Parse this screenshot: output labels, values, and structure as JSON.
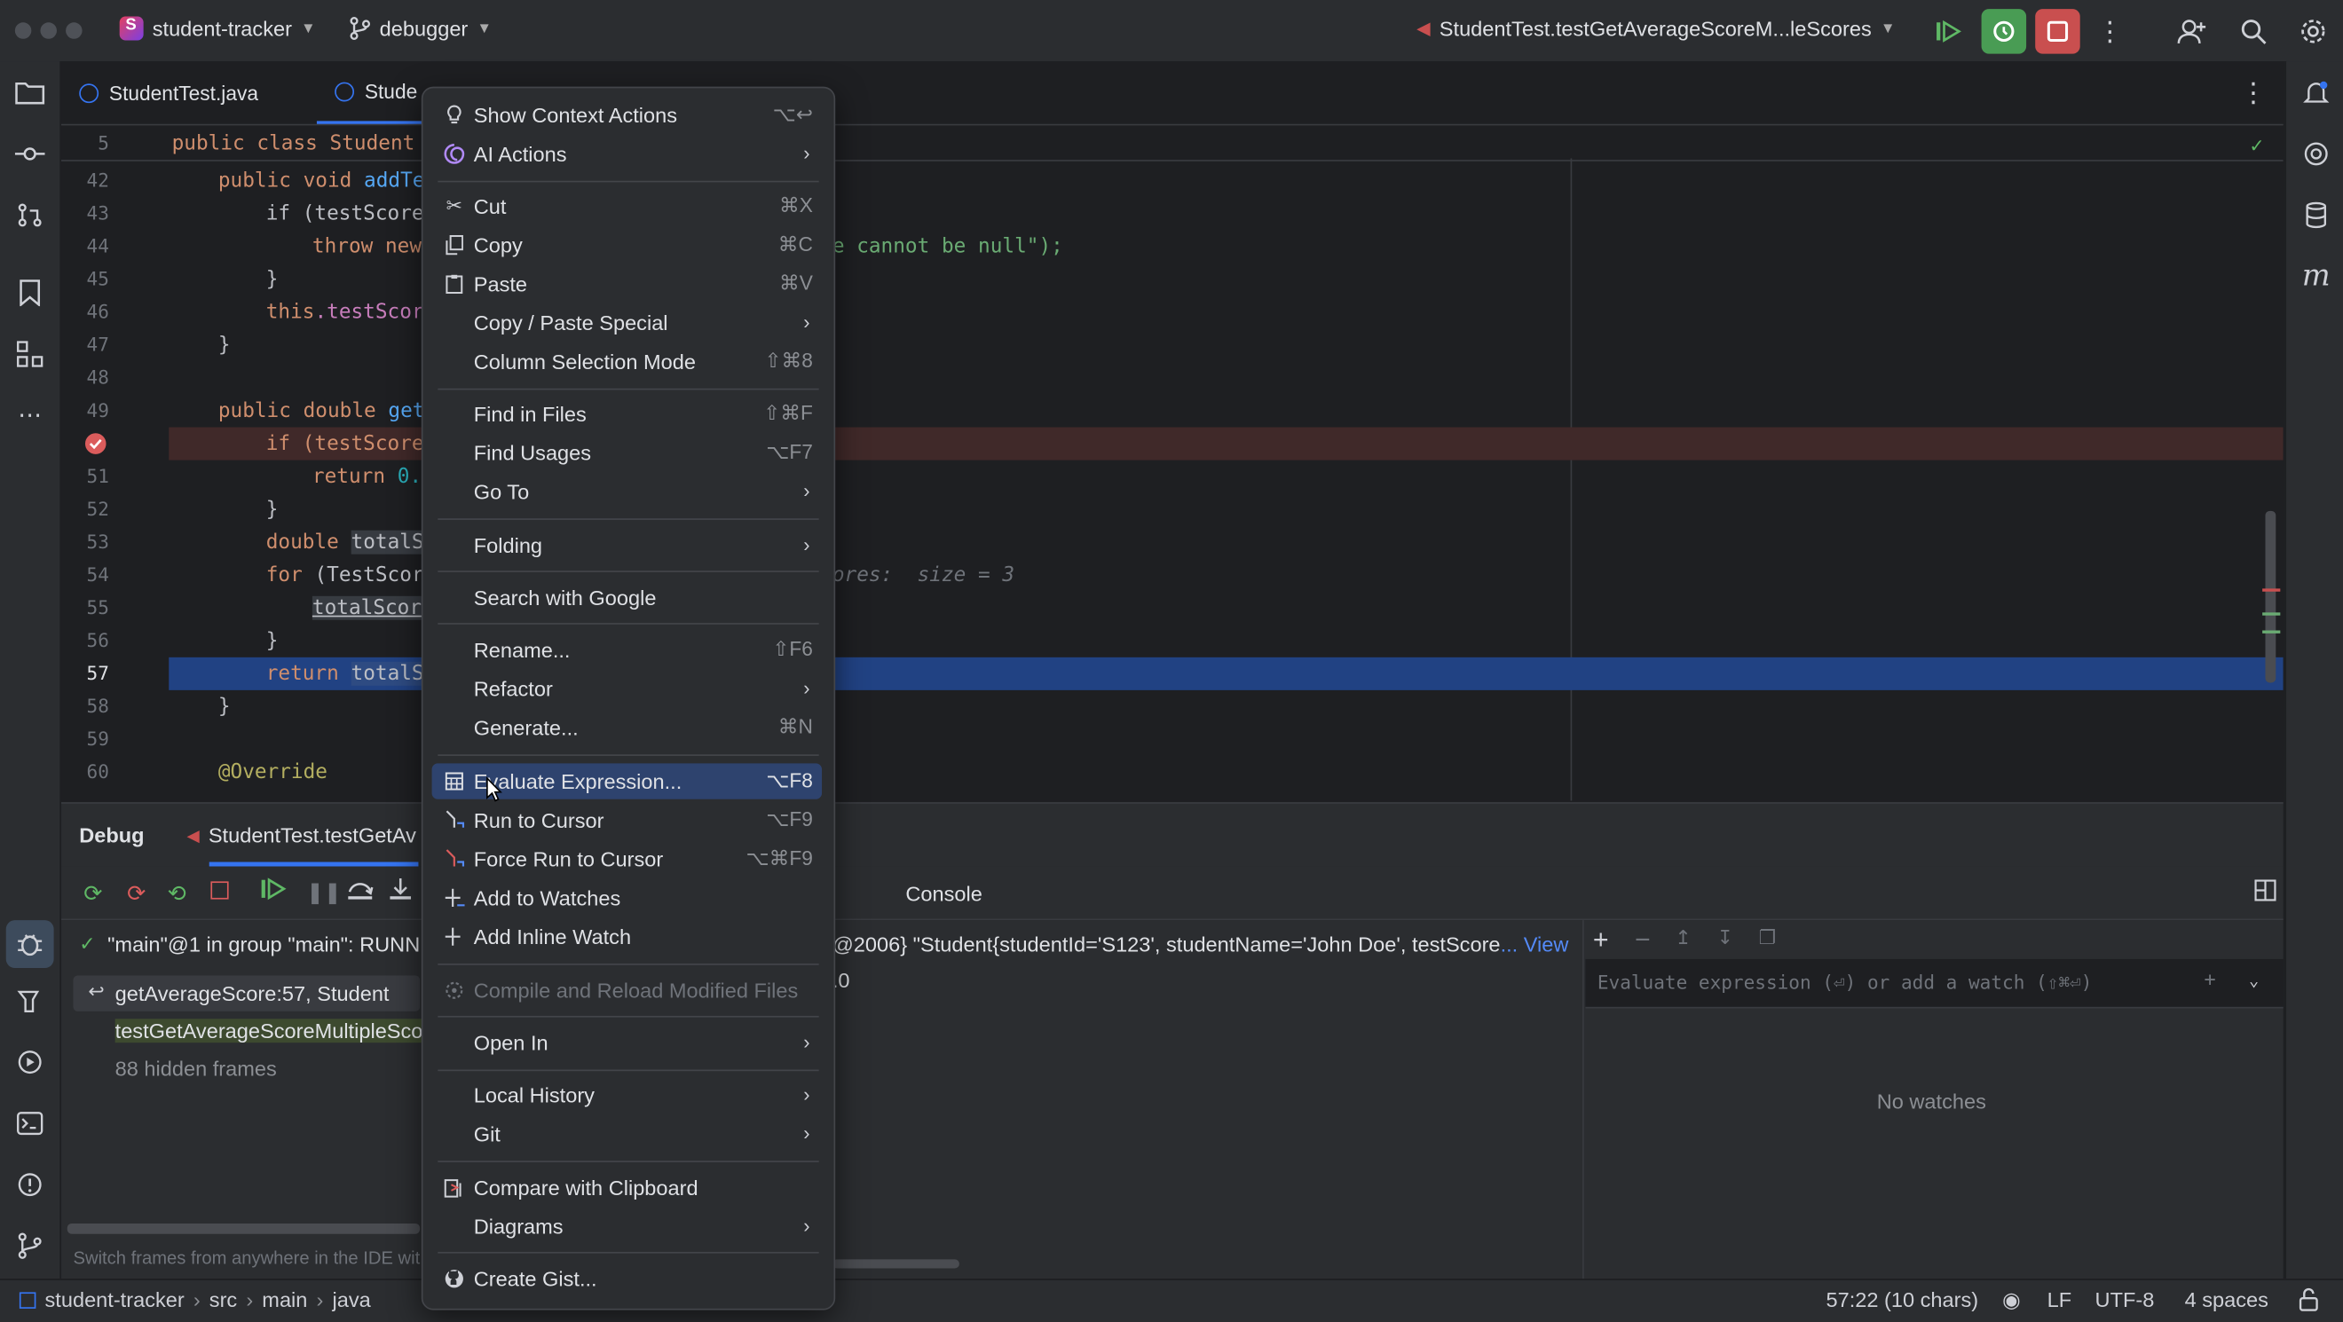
{
  "titlebar": {
    "project": "student-tracker",
    "project_badge": "S",
    "branch": "debugger",
    "run_config": "StudentTest.testGetAverageScoreM...leScores"
  },
  "tabs": [
    {
      "label": "StudentTest.java"
    },
    {
      "label": "Stude"
    }
  ],
  "editor": {
    "sticky_line": {
      "num": "5",
      "text": "public class Student"
    },
    "lines": [
      {
        "num": "42"
      },
      {
        "num": "43"
      },
      {
        "num": "44"
      },
      {
        "num": "45"
      },
      {
        "num": "46"
      },
      {
        "num": "47"
      },
      {
        "num": "48"
      },
      {
        "num": "49"
      },
      {
        "num": ""
      },
      {
        "num": "51"
      },
      {
        "num": "52"
      },
      {
        "num": "53"
      },
      {
        "num": "54"
      },
      {
        "num": "55"
      },
      {
        "num": "56"
      },
      {
        "num": "57"
      },
      {
        "num": "58"
      },
      {
        "num": "59"
      },
      {
        "num": "60"
      }
    ],
    "code": {
      "l42a": "public void ",
      "l42b": "addTe",
      "l43": "if (testScore",
      "l44a": "throw new",
      "l44b": "e cannot be null\");",
      "l45": "}",
      "l46a": "this",
      "l46b": ".testScor",
      "l47": "}",
      "l49a": "public double ",
      "l49b": "get",
      "l50": "if (testScore",
      "l51a": "return ",
      "l51b": "0.",
      "l52": "}",
      "l53a": "double ",
      "l53b": "totalS",
      "l54a": "for ",
      "l54b": "(TestScor",
      "l54hint": "ores:  size = 3",
      "l55": "totalScor",
      "l56": "}",
      "l57a": "return ",
      "l57b": "totalS",
      "l58": "}",
      "l60": "@Override"
    }
  },
  "debug": {
    "title": "Debug",
    "session_tab": "StudentTest.testGetAv",
    "console_tab": "Console",
    "thread": "\"main\"@1 in group \"main\": RUNNI",
    "frames": [
      {
        "label": "getAverageScore:57, Student"
      },
      {
        "label": "testGetAverageScoreMultipleSco"
      },
      {
        "label": "88 hidden frames"
      }
    ],
    "variable_value": "@2006} \"Student{studentId='S123', studentName='John Doe', testScore",
    "variable_view": "... View",
    "variable_line2": ".0",
    "watch_placeholder": "Evaluate expression (⏎) or add a watch (⇧⌘⏎)",
    "no_watches": "No watches",
    "hint": "Switch frames from anywhere in the IDE wit"
  },
  "statusbar": {
    "path": [
      "student-tracker",
      "src",
      "main",
      "java"
    ],
    "position": "57:22 (10 chars)",
    "line_sep": "LF",
    "encoding": "UTF-8",
    "indent": "4 spaces"
  },
  "menu": {
    "items": [
      {
        "label": "Show Context Actions",
        "shortcut": "⌥↩",
        "icon": "bulb-icon"
      },
      {
        "label": "AI Actions",
        "submenu": true,
        "icon": "ai-icon"
      },
      {
        "label": "Cut",
        "shortcut": "⌘X",
        "icon": "scissors-icon"
      },
      {
        "label": "Copy",
        "shortcut": "⌘C",
        "icon": "copy-icon"
      },
      {
        "label": "Paste",
        "shortcut": "⌘V",
        "icon": "clipboard-icon"
      },
      {
        "label": "Copy / Paste Special",
        "submenu": true
      },
      {
        "label": "Column Selection Mode",
        "shortcut": "⇧⌘8"
      },
      {
        "label": "Find in Files",
        "shortcut": "⇧⌘F"
      },
      {
        "label": "Find Usages",
        "shortcut": "⌥F7"
      },
      {
        "label": "Go To",
        "submenu": true
      },
      {
        "label": "Folding",
        "submenu": true
      },
      {
        "label": "Search with Google"
      },
      {
        "label": "Rename...",
        "shortcut": "⇧F6"
      },
      {
        "label": "Refactor",
        "submenu": true
      },
      {
        "label": "Generate...",
        "shortcut": "⌘N"
      },
      {
        "label": "Evaluate Expression...",
        "shortcut": "⌥F8",
        "icon": "calculator-icon",
        "selected": true
      },
      {
        "label": "Run to Cursor",
        "shortcut": "⌥F9",
        "icon": "run-to-cursor-icon"
      },
      {
        "label": "Force Run to Cursor",
        "shortcut": "⌥⌘F9",
        "icon": "force-run-icon"
      },
      {
        "label": "Add to Watches",
        "icon": "add-watch-icon"
      },
      {
        "label": "Add Inline Watch",
        "icon": "inline-watch-icon"
      },
      {
        "label": "Compile and Reload Modified Files",
        "disabled": true,
        "icon": "reload-icon"
      },
      {
        "label": "Open In",
        "submenu": true
      },
      {
        "label": "Local History",
        "submenu": true
      },
      {
        "label": "Git",
        "submenu": true
      },
      {
        "label": "Compare with Clipboard",
        "icon": "compare-icon"
      },
      {
        "label": "Diagrams",
        "submenu": true
      },
      {
        "label": "Create Gist...",
        "icon": "github-icon"
      }
    ]
  },
  "colors": {
    "accent": "#3574f0",
    "selection": "#2e436e",
    "execution_line": "#214283",
    "breakpoint_line": "#402929",
    "run_green": "#499c54",
    "stop_red": "#c94f4f"
  }
}
